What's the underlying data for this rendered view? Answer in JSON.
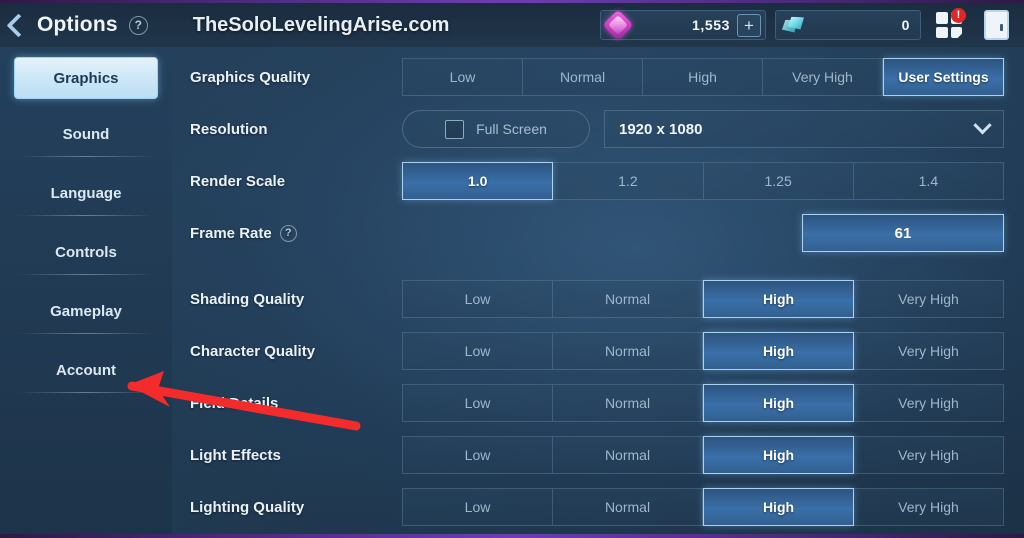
{
  "header": {
    "back_icon": "chevron-left-icon",
    "title": "Options",
    "help_label": "?",
    "site_title": "TheSoloLevelingArise.com",
    "currencies": [
      {
        "icon": "pink-crystal-icon",
        "value": "1,553",
        "plus_label": "+"
      },
      {
        "icon": "teal-gem-icon",
        "value": "0"
      }
    ],
    "menu_icon": "grid-menu-icon",
    "menu_badge": "!",
    "exit_icon": "door-exit-icon"
  },
  "sidebar": {
    "items": [
      {
        "label": "Graphics",
        "active": true
      },
      {
        "label": "Sound",
        "active": false
      },
      {
        "label": "Language",
        "active": false
      },
      {
        "label": "Controls",
        "active": false
      },
      {
        "label": "Gameplay",
        "active": false
      },
      {
        "label": "Account",
        "active": false
      }
    ]
  },
  "settings": {
    "graphics_quality": {
      "label": "Graphics Quality",
      "options": [
        "Low",
        "Normal",
        "High",
        "Very High",
        "User Settings"
      ],
      "selected": "User Settings"
    },
    "resolution": {
      "label": "Resolution",
      "fullscreen_label": "Full Screen",
      "fullscreen_checked": false,
      "value": "1920 x 1080",
      "dropdown_icon": "chevron-down-icon"
    },
    "render_scale": {
      "label": "Render Scale",
      "options": [
        "1.0",
        "1.2",
        "1.25",
        "1.4"
      ],
      "selected": "1.0"
    },
    "frame_rate": {
      "label": "Frame Rate",
      "help_label": "?",
      "value": "61"
    },
    "quality_rows": [
      {
        "label": "Shading Quality",
        "options": [
          "Low",
          "Normal",
          "High",
          "Very High"
        ],
        "selected": "High"
      },
      {
        "label": "Character Quality",
        "options": [
          "Low",
          "Normal",
          "High",
          "Very High"
        ],
        "selected": "High"
      },
      {
        "label": "Field Details",
        "options": [
          "Low",
          "Normal",
          "High",
          "Very High"
        ],
        "selected": "High"
      },
      {
        "label": "Light Effects",
        "options": [
          "Low",
          "Normal",
          "High",
          "Very High"
        ],
        "selected": "High"
      },
      {
        "label": "Lighting Quality",
        "options": [
          "Low",
          "Normal",
          "High",
          "Very High"
        ],
        "selected": "High"
      }
    ]
  },
  "annotation": {
    "arrow_color": "#f42b2b",
    "points_to": "Account"
  },
  "colors": {
    "accent_blue": "#3a6fa8",
    "active_nav": "#cbe6f7",
    "purple_edge": "#6b3fb0",
    "badge_red": "#e02727"
  }
}
